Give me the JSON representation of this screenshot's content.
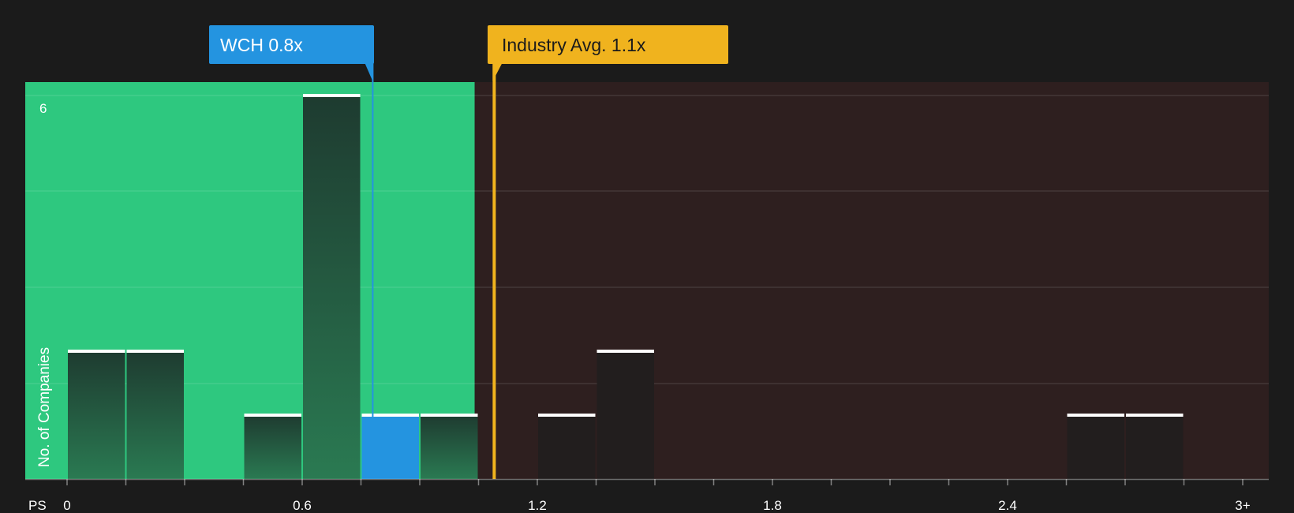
{
  "chart_data": {
    "type": "bar",
    "x_axis_label": "PS",
    "y_axis_label": "No. of Companies",
    "x_tick_labels": [
      "0",
      "0.6",
      "1.2",
      "1.8",
      "2.4",
      "3+"
    ],
    "x_tick_values": [
      0,
      0.6,
      1.2,
      1.8,
      2.4,
      3.0
    ],
    "y_tick_labels": [
      "6"
    ],
    "y_tick_values": [
      6
    ],
    "xlim": [
      -0.1,
      3.08
    ],
    "ylim": [
      0,
      6.2
    ],
    "bin_width": 0.15,
    "bars": [
      {
        "x_start": 0.0,
        "x_end": 0.15,
        "count": 2
      },
      {
        "x_start": 0.15,
        "x_end": 0.3,
        "count": 2
      },
      {
        "x_start": 0.45,
        "x_end": 0.6,
        "count": 1
      },
      {
        "x_start": 0.6,
        "x_end": 0.75,
        "count": 6
      },
      {
        "x_start": 0.75,
        "x_end": 0.9,
        "count": 1,
        "highlight": true
      },
      {
        "x_start": 0.9,
        "x_end": 1.05,
        "count": 1
      },
      {
        "x_start": 1.2,
        "x_end": 1.35,
        "count": 1
      },
      {
        "x_start": 1.35,
        "x_end": 1.5,
        "count": 2
      },
      {
        "x_start": 2.55,
        "x_end": 2.7,
        "count": 1
      },
      {
        "x_start": 2.7,
        "x_end": 2.85,
        "count": 1
      }
    ],
    "undervalued_zone_end": 1.04,
    "company": {
      "label": "WCH 0.8x",
      "value": 0.78
    },
    "industry": {
      "label": "Industry Avg. 1.1x",
      "value": 1.09
    },
    "colors": {
      "background": "#1b1b1b",
      "undervalued_zone": "#2ec87f",
      "overvalued_zone": "#2e1f1f",
      "company": "#2494e0",
      "industry": "#f0b31e",
      "bar_in_green": "#1f3d30",
      "bar_in_dark": "#221e1e",
      "bar_cap": "#ffffff",
      "grid": "#4a4242"
    }
  }
}
